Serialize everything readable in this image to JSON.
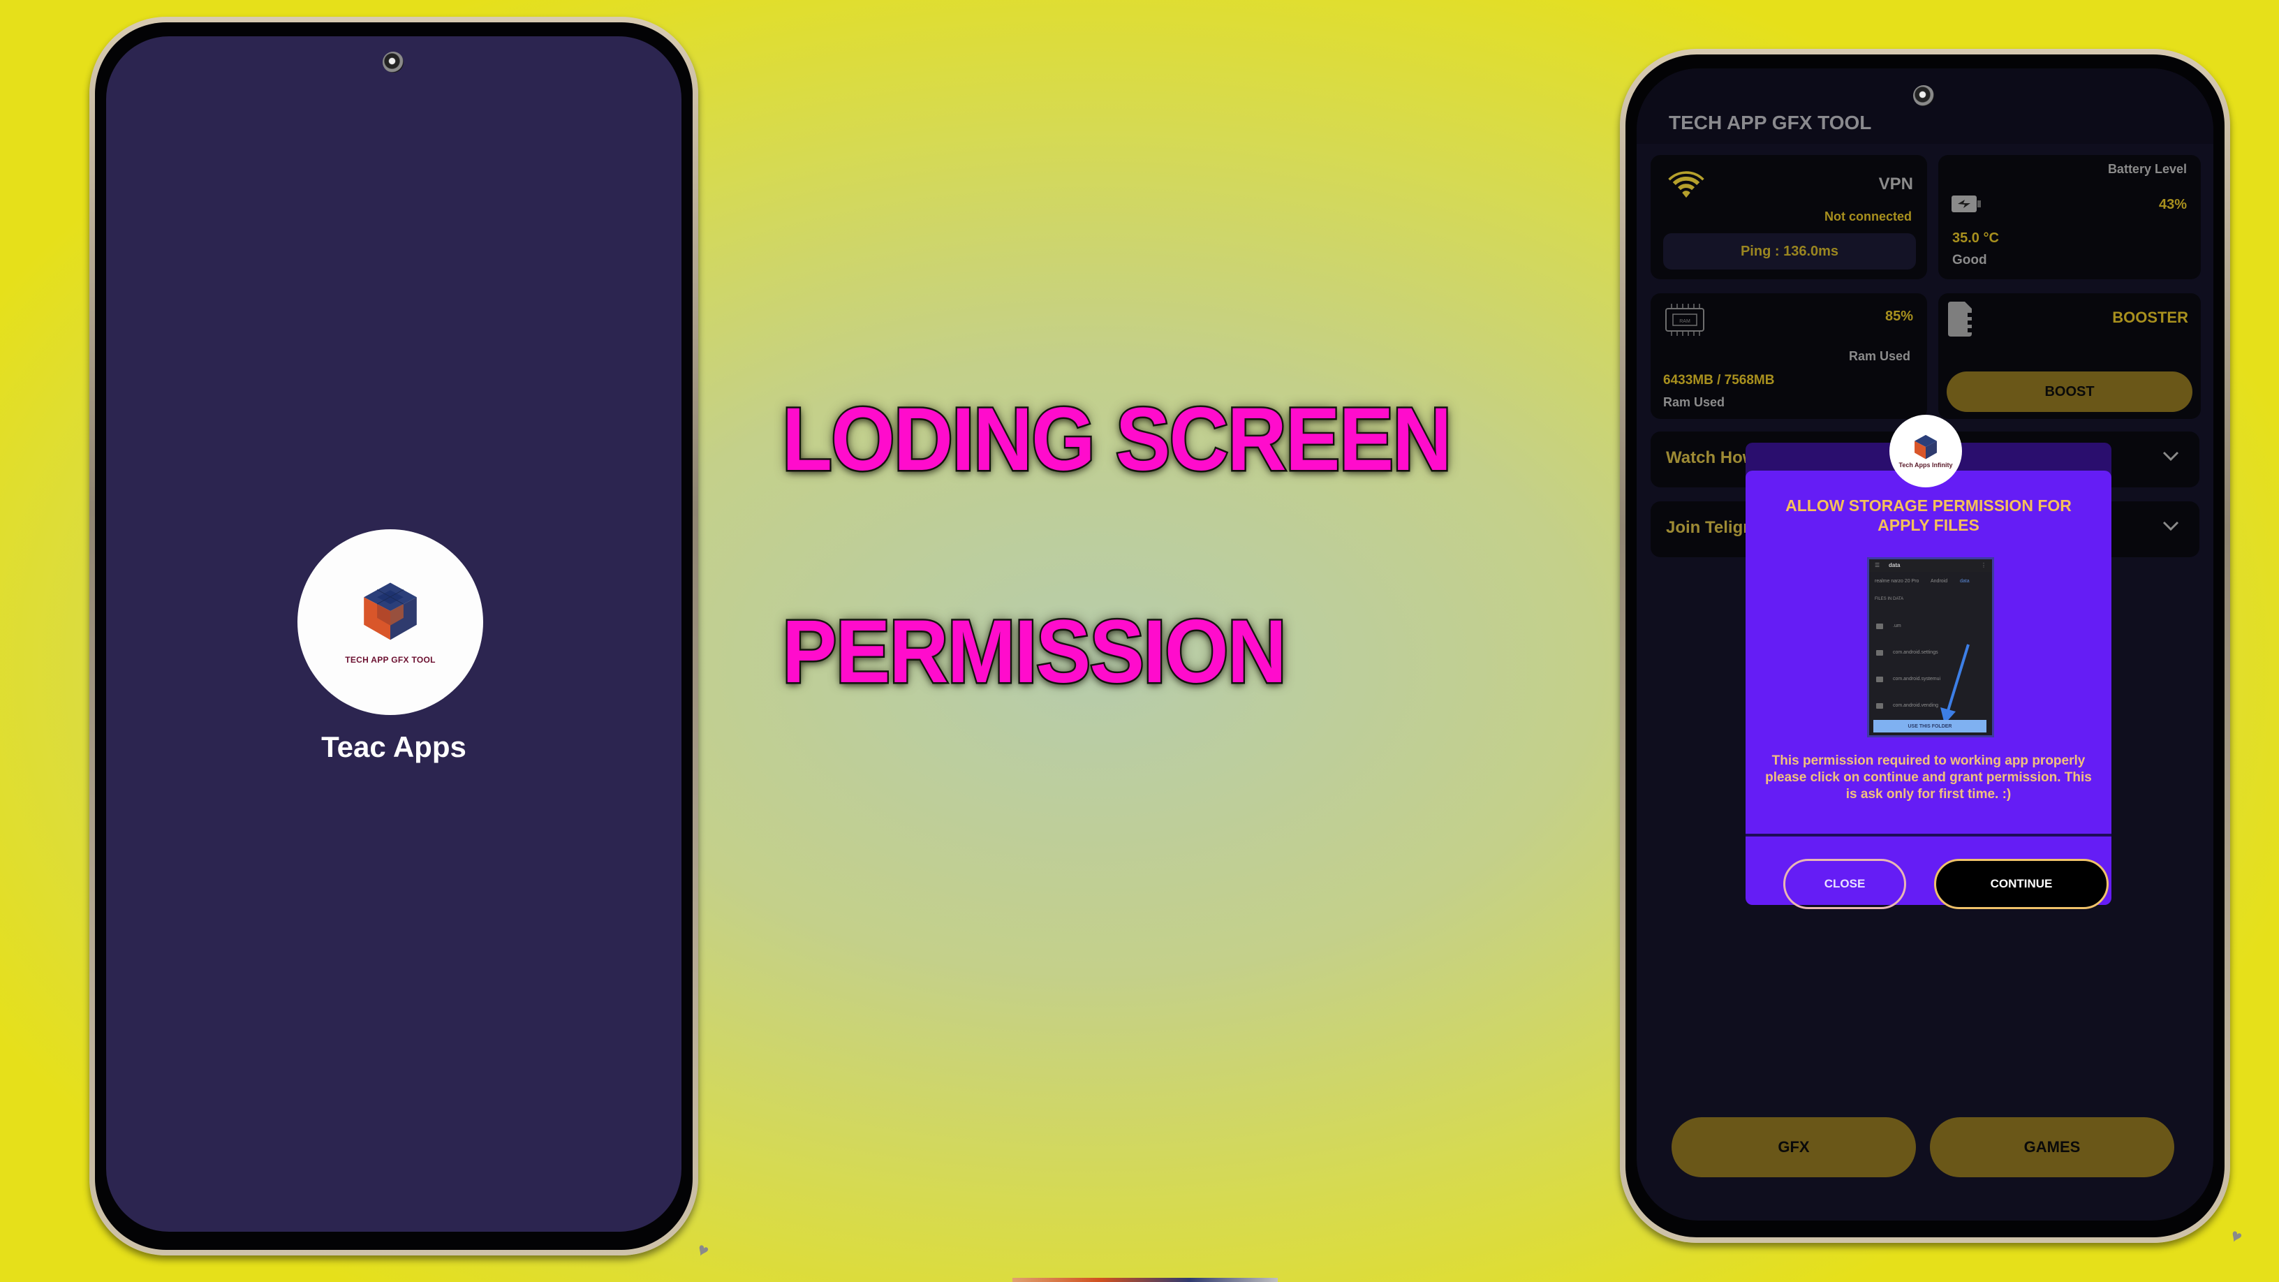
{
  "banners": {
    "loading": "LODING SCREEN",
    "permission": "PERMISSION"
  },
  "splash": {
    "logo_caption": "TECH APP GFX TOOL",
    "title": "Teac Apps",
    "background_color": "#2c2550"
  },
  "app": {
    "title": "TECH APP GFX TOOL",
    "accent_color": "#a8901e",
    "vpn_card": {
      "icon": "wifi-icon",
      "label": "VPN",
      "status": "Not connected",
      "ping": "Ping : 136.0ms"
    },
    "battery_card": {
      "icon": "battery-charging-icon",
      "label": "Battery Level",
      "percent": "43%",
      "temperature": "35.0 °C",
      "health": "Good"
    },
    "ram_card": {
      "icon": "ram-chip-icon",
      "icon_text": "RAM",
      "percent": "85%",
      "label_right": "Ram Used",
      "usage": "6433MB / 7568MB",
      "label_bottom": "Ram Used"
    },
    "booster_card": {
      "icon": "sd-card-icon",
      "label": "BOOSTER",
      "button": "BOOST"
    },
    "expanders": [
      {
        "label": "Watch How",
        "icon": "chevron-down-icon"
      },
      {
        "label": "Join Teligra",
        "icon": "chevron-down-icon"
      }
    ],
    "bottom_buttons": {
      "gfx": "GFX",
      "games": "GAMES"
    }
  },
  "dialog": {
    "logo_caption": "Tech Apps Infinity",
    "title": "ALLOW STORAGE PERMISSION FOR APPLY FILES",
    "preview": {
      "folder_title": "data",
      "breadcrumb": [
        "realme narzo 20 Pro",
        "Android",
        "data"
      ],
      "section_label": "FILES IN DATA",
      "items": [
        ".um",
        "com.android.settings",
        "com.android.systemui",
        "com.android.vending"
      ],
      "button": "USE THIS FOLDER"
    },
    "message": "This permission required to working app properly please click on continue and grant permission. This is ask only for first time. :)",
    "close_button": "CLOSE",
    "continue_button": "CONTINUE",
    "background_color": "#651df5"
  }
}
